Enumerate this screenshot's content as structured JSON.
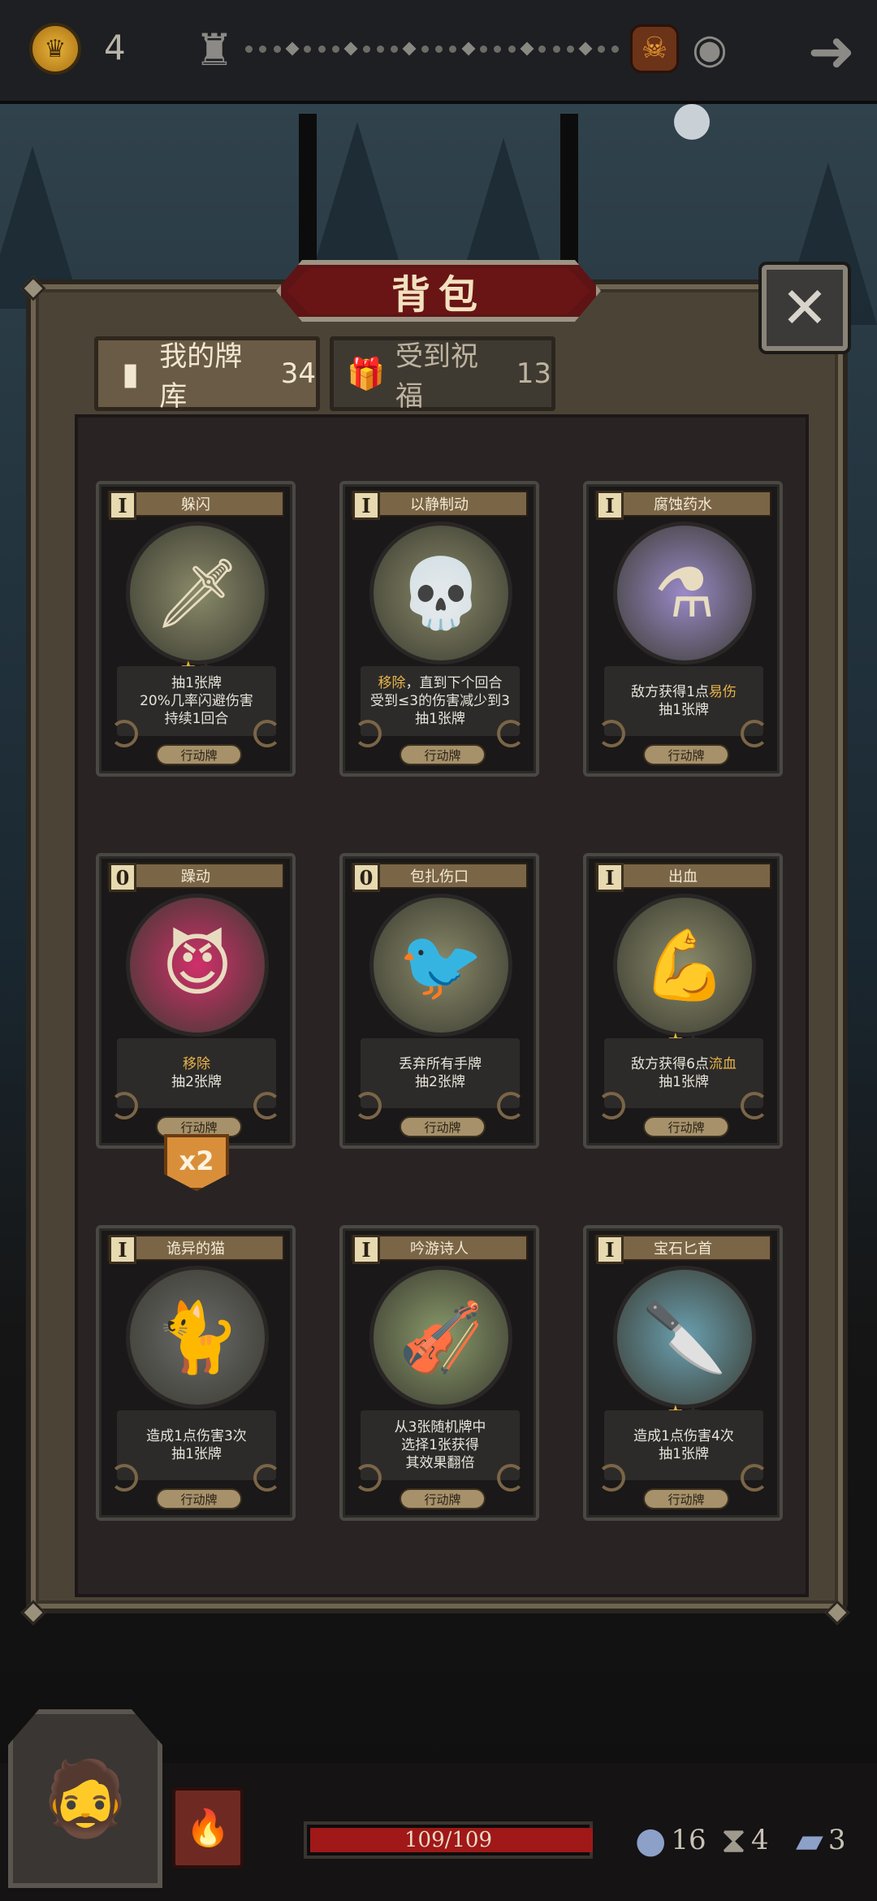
{
  "topbar": {
    "coin_icon": "crown-coin-icon",
    "coin_count": "4",
    "map_icon": "tower-icon",
    "boss_icon": "demon-boss-icon",
    "view_icon": "eye-icon",
    "back_icon": "back-arrow-icon"
  },
  "dialog": {
    "title": "背包",
    "close_icon": "close-icon",
    "tabs": [
      {
        "label": "我的牌库",
        "count": "34",
        "icon": "card-icon"
      },
      {
        "label": "受到祝福",
        "count": "13",
        "icon": "gift-icon"
      }
    ]
  },
  "cards": [
    {
      "cost": "I",
      "name": "躲闪",
      "art": "hooded-dodger-icon",
      "stars": 1,
      "lines": [
        "抽1张牌",
        "20%几率闪避伤害",
        "持续1回合"
      ],
      "type": "行动牌"
    },
    {
      "cost": "I",
      "name": "以静制动",
      "art": "skull-icon",
      "stars": 0,
      "lines": [
        "移除，直到下个回合",
        "受到≤3的伤害减少到3",
        "抽1张牌"
      ],
      "highlight": "移除",
      "type": "行动牌"
    },
    {
      "cost": "I",
      "name": "腐蚀药水",
      "art": "potion-icon",
      "stars": 0,
      "lines": [
        "敌方获得1点易伤",
        "抽1张牌"
      ],
      "highlight": "易伤",
      "type": "行动牌"
    },
    {
      "cost": "0",
      "name": "躁动",
      "art": "rage-icon",
      "stars": 0,
      "lines": [
        "移除",
        "抽2张牌"
      ],
      "highlight": "移除",
      "type": "行动牌",
      "copies": "x2"
    },
    {
      "cost": "0",
      "name": "包扎伤口",
      "art": "plague-doctor-icon",
      "stars": 0,
      "lines": [
        "丢弃所有手牌",
        "抽2张牌"
      ],
      "type": "行动牌"
    },
    {
      "cost": "I",
      "name": "出血",
      "art": "bleeding-arm-icon",
      "stars": 1,
      "lines": [
        "敌方获得6点流血",
        "抽1张牌"
      ],
      "highlight": "流血",
      "type": "行动牌"
    },
    {
      "cost": "I",
      "name": "诡异的猫",
      "art": "cat-icon",
      "stars": 0,
      "lines": [
        "造成1点伤害3次",
        "抽1张牌"
      ],
      "type": "行动牌"
    },
    {
      "cost": "I",
      "name": "吟游诗人",
      "art": "bard-icon",
      "stars": 0,
      "lines": [
        "从3张随机牌中",
        "选择1张获得",
        "其效果翻倍"
      ],
      "type": "行动牌"
    },
    {
      "cost": "I",
      "name": "宝石匕首",
      "art": "dagger-icon",
      "stars": 1,
      "lines": [
        "造成1点伤害4次",
        "抽1张牌"
      ],
      "type": "行动牌"
    }
  ],
  "bottom": {
    "portrait_icon": "hero-portrait-icon",
    "book_icon": "spellbook-icon",
    "hp_text": "109/109",
    "hp_fraction": 1.0,
    "stats": [
      {
        "icon": "orb-icon",
        "value": "16"
      },
      {
        "icon": "hourglass-icon",
        "value": "4"
      },
      {
        "icon": "cards-icon",
        "value": "3"
      }
    ]
  },
  "colors": {
    "hp": "#a01818",
    "accent": "#e6b44a",
    "banner": "#6a1515"
  }
}
